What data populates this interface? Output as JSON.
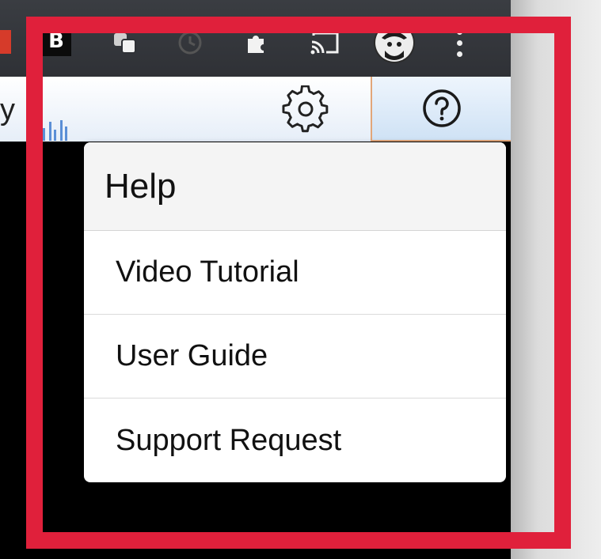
{
  "browser_toolbar": {
    "extensions": [
      {
        "name": "red-extension-icon"
      },
      {
        "name": "b-extension-icon",
        "label": "B"
      },
      {
        "name": "tab-groups-icon"
      },
      {
        "name": "clock-icon"
      },
      {
        "name": "puzzle-icon"
      },
      {
        "name": "cast-icon"
      },
      {
        "name": "profile-avatar"
      },
      {
        "name": "more-menu-icon"
      }
    ]
  },
  "app_header": {
    "partial_title": "y",
    "settings_icon": "gear-icon",
    "help_icon": "help-circle-icon"
  },
  "help_menu": {
    "title": "Help",
    "items": [
      {
        "label": "Video Tutorial"
      },
      {
        "label": "User Guide"
      },
      {
        "label": "Support Request"
      }
    ]
  },
  "colors": {
    "highlight_frame": "#e0203b",
    "help_button_border": "#e2a679",
    "sparkline": "#5b8fd6"
  }
}
